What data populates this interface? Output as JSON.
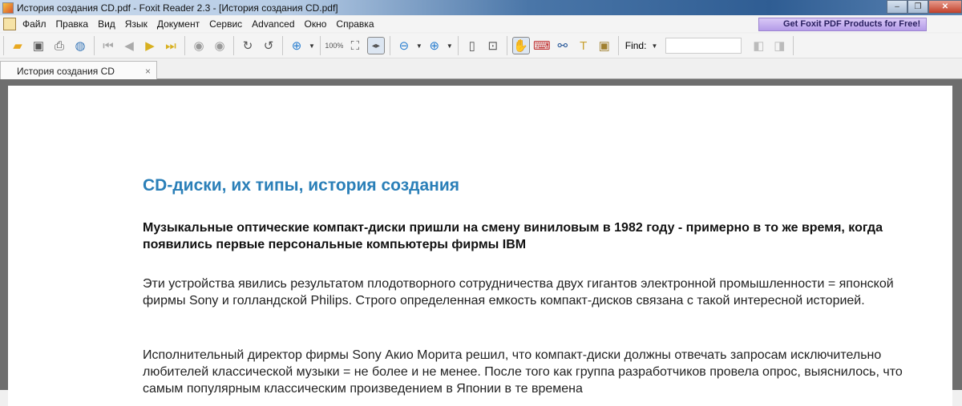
{
  "window": {
    "title": "История создания CD.pdf - Foxit Reader 2.3 - [История создания CD.pdf]",
    "minimize": "–",
    "restore": "❐",
    "close": "✕"
  },
  "menu": [
    "Файл",
    "Правка",
    "Вид",
    "Язык",
    "Документ",
    "Сервис",
    "Advanced",
    "Окно",
    "Справка"
  ],
  "promo": "Get Foxit PDF Products for Free!",
  "toolbar": {
    "find_label": "Find:",
    "find_value": ""
  },
  "tab": {
    "label": "История создания CD",
    "close": "×"
  },
  "document": {
    "heading": "CD-диски, их типы, история создания",
    "lead": "Музыкальные оптические компакт-диски пришли на смену виниловым в 1982 году - примерно в то же время, когда появились первые персональные компьютеры фирмы IBM",
    "paragraphs": [
      "Эти устройства явились результатом плодотворного сотрудничества двух гигантов электронной промышленности = японской фирмы Sony и голландской Philips. Строго определенная емкость компакт-дисков связана с такой интересной историей.",
      "Исполнительный директор фирмы Sony Акио Морита решил, что компакт-диски должны отвечать запросам исключительно любителей классической музыки = не более и не менее. После того как группа разработчиков провела опрос, выяснилось, что самым популярным классическим произведением в Японии в те времена"
    ]
  }
}
